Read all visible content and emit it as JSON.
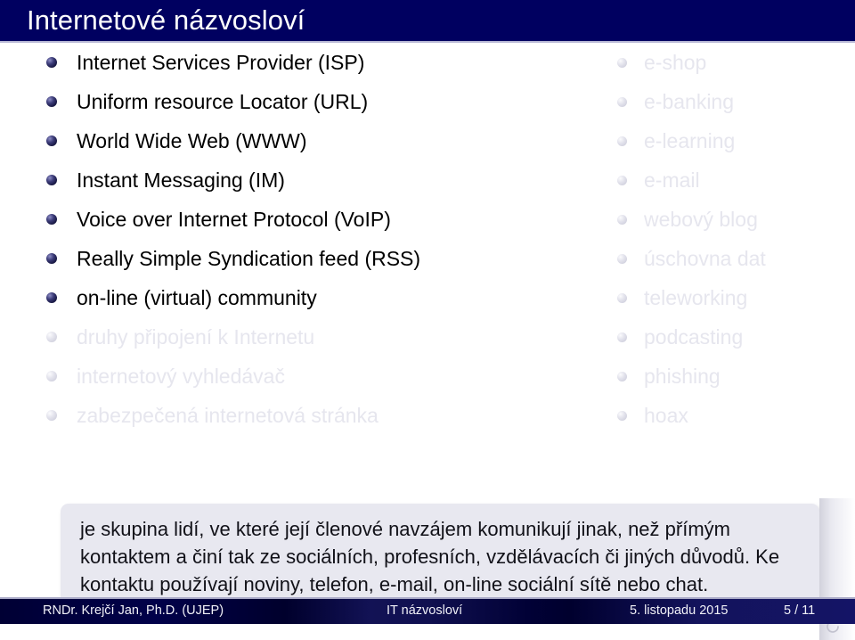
{
  "slide": {
    "title": "Internetové názvosloví",
    "title_bar_color": "#000060",
    "accent_color": "#16163f"
  },
  "left_column": {
    "items": [
      {
        "label": "Internet Services Provider (ISP)",
        "dimmed": false
      },
      {
        "label": "Uniform resource Locator (URL)",
        "dimmed": false
      },
      {
        "label": "World Wide Web (WWW)",
        "dimmed": false
      },
      {
        "label": "Instant Messaging (IM)",
        "dimmed": false
      },
      {
        "label": "Voice over Internet Protocol (VoIP)",
        "dimmed": false
      },
      {
        "label": "Really Simple Syndication feed (RSS)",
        "dimmed": false
      },
      {
        "label": "on-line (virtual) community",
        "dimmed": false
      },
      {
        "label": "druhy připojení k Internetu",
        "dimmed": true
      },
      {
        "label": "internetový vyhledávač",
        "dimmed": true
      },
      {
        "label": "zabezpečená internetová stránka",
        "dimmed": true
      }
    ]
  },
  "right_column": {
    "items": [
      {
        "label": "e-shop",
        "dimmed": true
      },
      {
        "label": "e-banking",
        "dimmed": true
      },
      {
        "label": "e-learning",
        "dimmed": true
      },
      {
        "label": "e-mail",
        "dimmed": true
      },
      {
        "label": "webový blog",
        "dimmed": true
      },
      {
        "label": "úschovna dat",
        "dimmed": true
      },
      {
        "label": "teleworking",
        "dimmed": true
      },
      {
        "label": "podcasting",
        "dimmed": true
      },
      {
        "label": "phishing",
        "dimmed": true
      },
      {
        "label": "hoax",
        "dimmed": true
      }
    ]
  },
  "definition_box": {
    "text": "je skupina lidí, ve které její členové navzájem komunikují jinak, než přímým kontaktem a činí tak ze sociálních, profesních, vzdělávacích či jiných důvodů. Ke kontaktu používají noviny, telefon, e-mail, on-line sociální sítě nebo chat.",
    "background_color": "#e8e8f0"
  },
  "footer": {
    "author": "RNDr. Krejčí Jan, Ph.D.  (UJEP)",
    "subject": "IT názvosloví",
    "date": "5. listopadu 2015",
    "pages": "5 / 11"
  },
  "icons": {
    "reload": "reload-icon"
  }
}
